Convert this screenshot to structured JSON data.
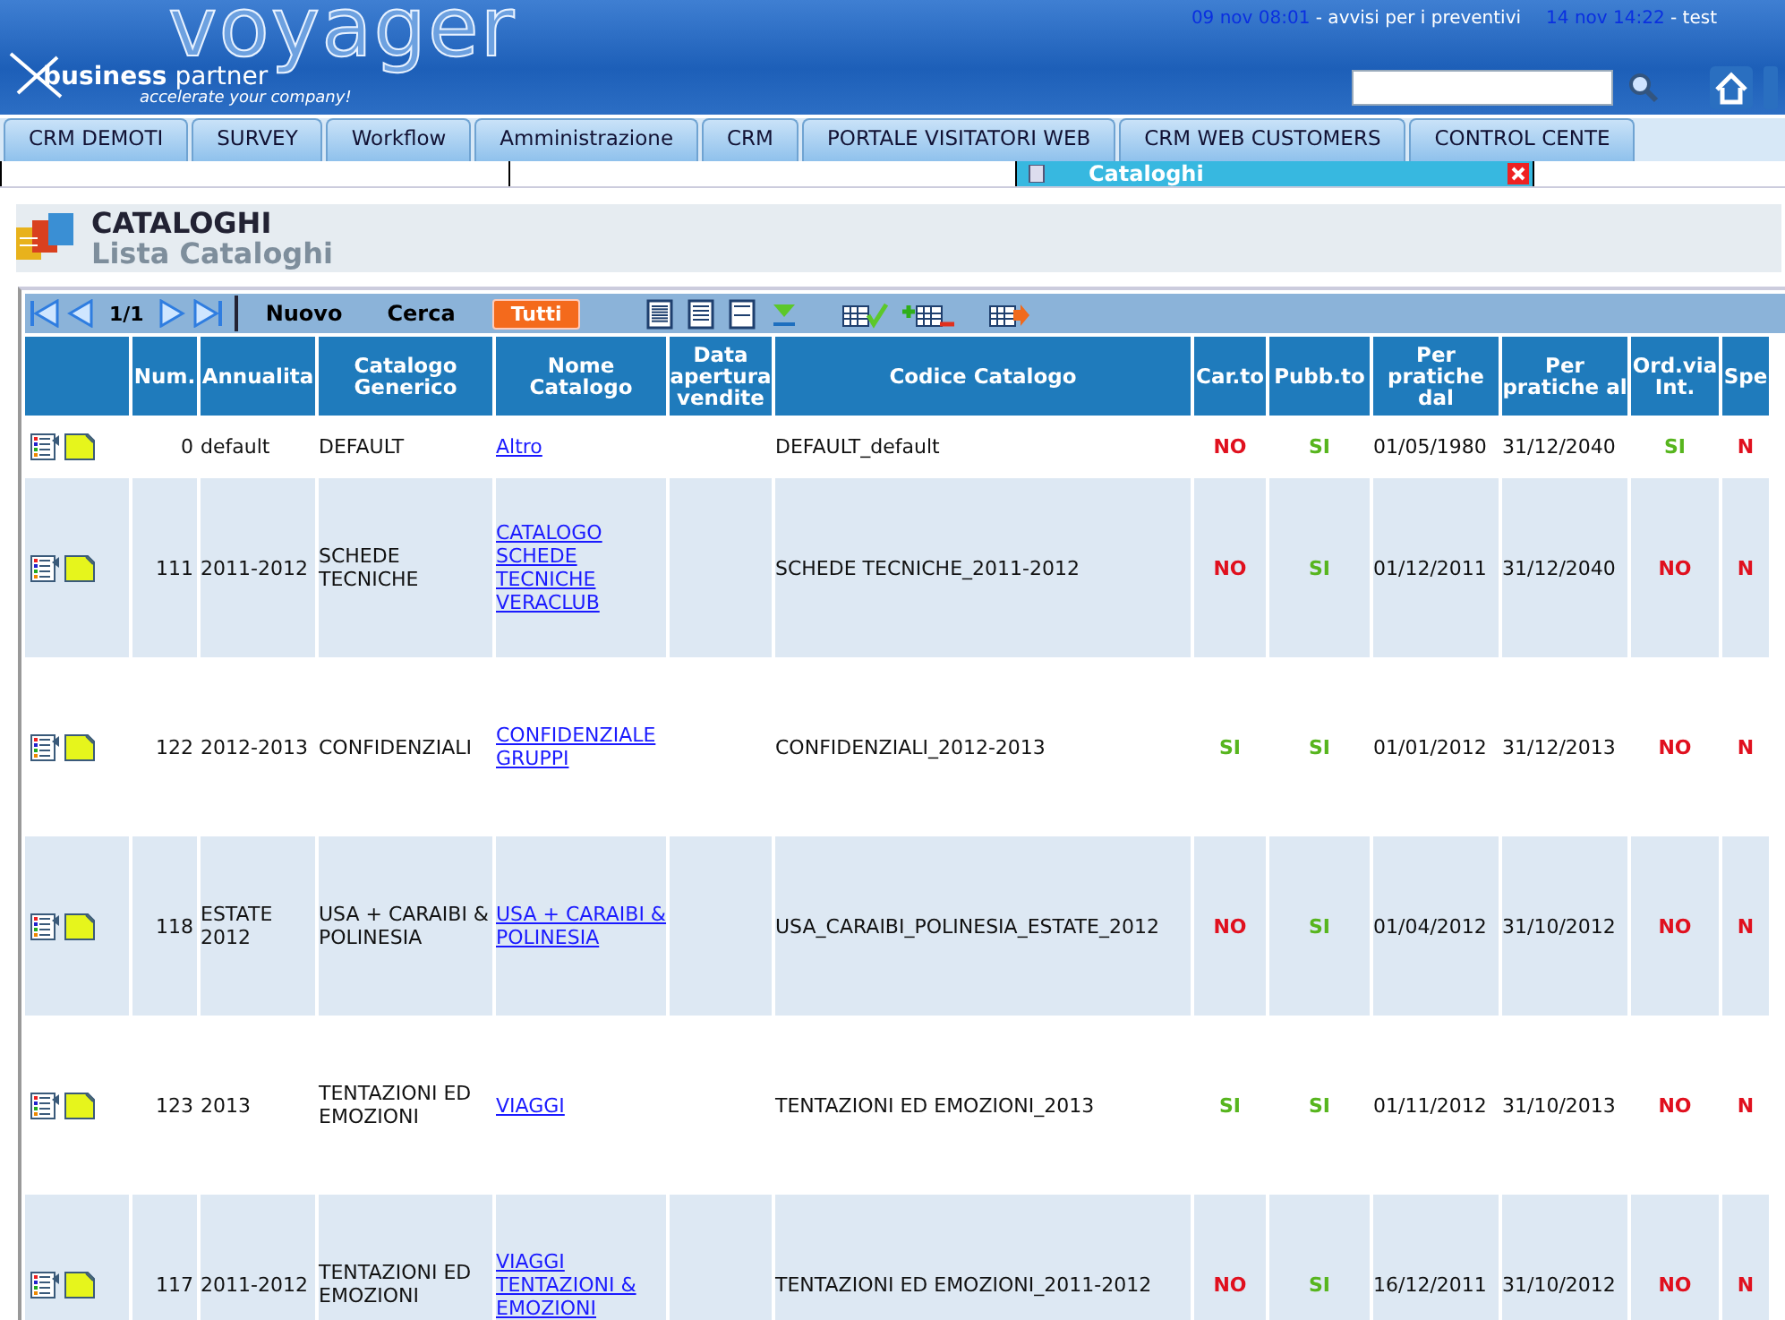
{
  "header": {
    "product": "voyager",
    "brand_bold": "business",
    "brand_rest": "partner",
    "tagline": "accelerate your company!",
    "notices": [
      {
        "time": "09 nov 08:01",
        "text": " - avvisi per i preventivi"
      },
      {
        "time": "14 nov 14:22",
        "text": " - test"
      }
    ]
  },
  "menu_tabs": [
    "CRM DEMOTI",
    "SURVEY",
    "Workflow",
    "Amministrazione",
    "CRM",
    "PORTALE VISITATORI WEB",
    "CRM WEB CUSTOMERS",
    "CONTROL CENTE"
  ],
  "open_window_tab": {
    "title": "Cataloghi"
  },
  "page": {
    "title": "CATALOGHI",
    "subtitle": "Lista Cataloghi"
  },
  "toolbar": {
    "pager": "1/1",
    "new": "Nuovo",
    "search": "Cerca",
    "all": "Tutti"
  },
  "table": {
    "columns": [
      "Num.",
      "Annualita",
      "Catalogo Generico",
      "Nome Catalogo",
      "Data apertura vendite",
      "Codice Catalogo",
      "Car.to",
      "Pubb.to",
      "Per pratiche dal",
      "Per pratiche al",
      "Ord.via Int.",
      "Spe"
    ],
    "rows": [
      {
        "num": "0",
        "year": "default",
        "generic": "DEFAULT",
        "name": "Altro",
        "code": "DEFAULT_default",
        "cart": {
          "text": "NO",
          "on": false
        },
        "pub": {
          "text": "SI",
          "on": true
        },
        "from": "01/05/1980",
        "to": "31/12/2040",
        "order": {
          "text": "SI",
          "on": true
        },
        "spe": {
          "text": "N",
          "on": false
        }
      },
      {
        "num": "111",
        "year": "2011-2012",
        "generic": "SCHEDE TECNICHE",
        "name": "CATALOGO SCHEDE TECNICHE VERACLUB",
        "code": "SCHEDE TECNICHE_2011-2012",
        "cart": {
          "text": "NO",
          "on": false
        },
        "pub": {
          "text": "SI",
          "on": true
        },
        "from": "01/12/2011",
        "to": "31/12/2040",
        "order": {
          "text": "NO",
          "on": false
        },
        "spe": {
          "text": "N",
          "on": false
        }
      },
      {
        "num": "122",
        "year": "2012-2013",
        "generic": "CONFIDENZIALI",
        "name": "CONFIDENZIALE GRUPPI",
        "code": "CONFIDENZIALI_2012-2013",
        "cart": {
          "text": "SI",
          "on": true
        },
        "pub": {
          "text": "SI",
          "on": true
        },
        "from": "01/01/2012",
        "to": "31/12/2013",
        "order": {
          "text": "NO",
          "on": false
        },
        "spe": {
          "text": "N",
          "on": false
        }
      },
      {
        "num": "118",
        "year": "ESTATE 2012",
        "generic": "USA + CARAIBI & POLINESIA",
        "name": "USA + CARAIBI & POLINESIA",
        "code": "USA_CARAIBI_POLINESIA_ESTATE_2012",
        "cart": {
          "text": "NO",
          "on": false
        },
        "pub": {
          "text": "SI",
          "on": true
        },
        "from": "01/04/2012",
        "to": "31/10/2012",
        "order": {
          "text": "NO",
          "on": false
        },
        "spe": {
          "text": "N",
          "on": false
        }
      },
      {
        "num": "123",
        "year": "2013",
        "generic": "TENTAZIONI ED EMOZIONI",
        "name": "VIAGGI",
        "code": "TENTAZIONI ED EMOZIONI_2013",
        "cart": {
          "text": "SI",
          "on": true
        },
        "pub": {
          "text": "SI",
          "on": true
        },
        "from": "01/11/2012",
        "to": "31/10/2013",
        "order": {
          "text": "NO",
          "on": false
        },
        "spe": {
          "text": "N",
          "on": false
        }
      },
      {
        "num": "117",
        "year": "2011-2012",
        "generic": "TENTAZIONI ED EMOZIONI",
        "name": "VIAGGI TENTAZIONI & EMOZIONI",
        "code": "TENTAZIONI ED EMOZIONI_2011-2012",
        "cart": {
          "text": "NO",
          "on": false
        },
        "pub": {
          "text": "SI",
          "on": true
        },
        "from": "16/12/2011",
        "to": "31/10/2012",
        "order": {
          "text": "NO",
          "on": false
        },
        "spe": {
          "text": "N",
          "on": false
        }
      }
    ]
  }
}
